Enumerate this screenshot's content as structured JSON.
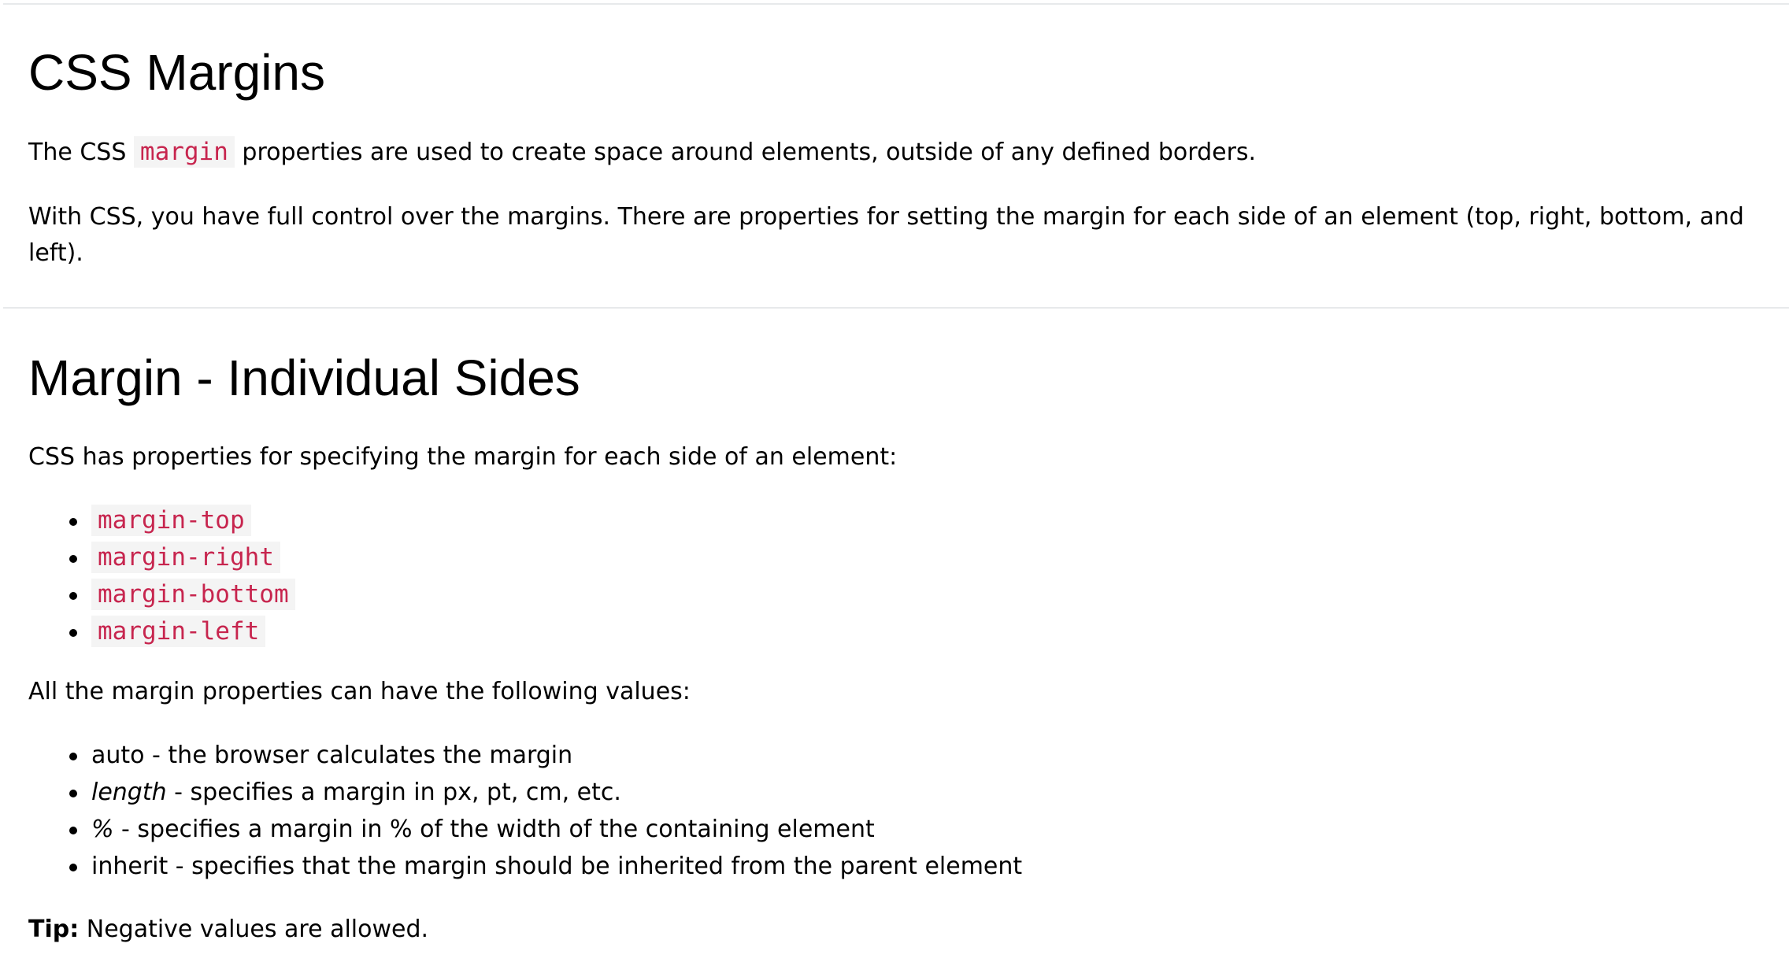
{
  "section_margins": {
    "title": "CSS Margins",
    "intro_before": "The CSS ",
    "intro_code": "margin",
    "intro_after": " properties are used to create space around elements, outside of any defined borders.",
    "control_text": "With CSS, you have full control over the margins. There are properties for setting the margin for each side of an element (top, right, bottom, and left)."
  },
  "section_sides": {
    "title": "Margin - Individual Sides",
    "intro": "CSS has properties for specifying the margin for each side of an element:",
    "properties": [
      "margin-top",
      "margin-right",
      "margin-bottom",
      "margin-left"
    ],
    "values_intro": "All the margin properties can have the following values:",
    "values": [
      {
        "term": "auto",
        "desc": " - the browser calculates the margin"
      },
      {
        "term": "length",
        "desc": " - specifies a margin in px, pt, cm, etc."
      },
      {
        "term": "%",
        "desc": " - specifies a margin in % of the width of the containing element"
      },
      {
        "term": "inherit",
        "desc": " - specifies that the margin should be inherited from the parent element"
      }
    ],
    "tip_label": "Tip:",
    "tip_text": " Negative values are allowed."
  },
  "colors": {
    "code_text": "#c7254e",
    "code_bg": "#f4f4f4",
    "divider": "#e7e9eb"
  }
}
